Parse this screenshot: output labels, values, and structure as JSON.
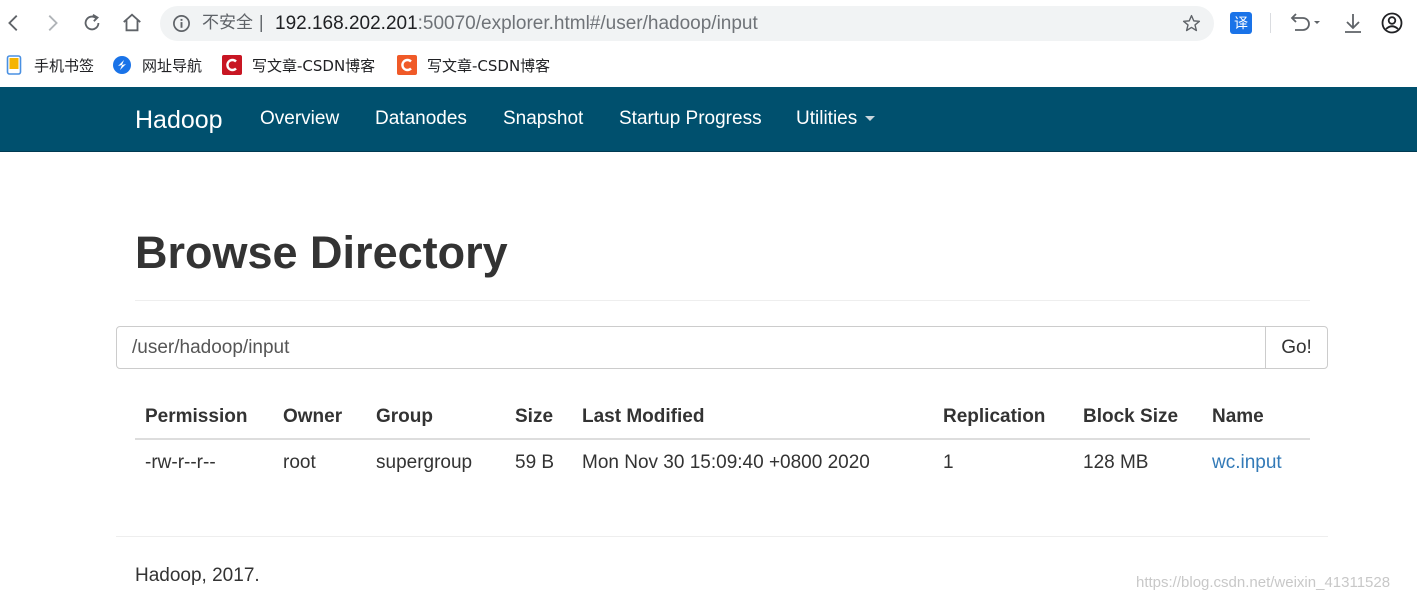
{
  "browser": {
    "security_label": "不安全 |",
    "url_host": "192.168.202.201",
    "url_rest": ":50070/explorer.html#/user/hadoop/input",
    "translate_label": "译",
    "bookmarks": [
      {
        "label": "手机书签",
        "icon": "phone-bookmark-icon",
        "color": "#4a90e2"
      },
      {
        "label": "网址导航",
        "icon": "nav-site-icon",
        "color": "#1a73e8"
      },
      {
        "label": "写文章-CSDN博客",
        "icon": "csdn-icon",
        "color": "#c81623"
      },
      {
        "label": "写文章-CSDN博客",
        "icon": "csdn-icon",
        "color": "#f05a28"
      }
    ]
  },
  "navbar": {
    "brand": "Hadoop",
    "items": [
      "Overview",
      "Datanodes",
      "Snapshot",
      "Startup Progress",
      "Utilities"
    ],
    "background": "#00506e"
  },
  "page": {
    "title": "Browse Directory",
    "path_value": "/user/hadoop/input",
    "go_label": "Go!"
  },
  "table": {
    "headers": [
      "Permission",
      "Owner",
      "Group",
      "Size",
      "Last Modified",
      "Replication",
      "Block Size",
      "Name"
    ],
    "rows": [
      [
        "-rw-r--r--",
        "root",
        "supergroup",
        "59 B",
        "Mon Nov 30 15:09:40 +0800 2020",
        "1",
        "128 MB",
        "wc.input"
      ]
    ]
  },
  "footer": {
    "text": "Hadoop, 2017."
  },
  "watermark": "https://blog.csdn.net/weixin_41311528"
}
